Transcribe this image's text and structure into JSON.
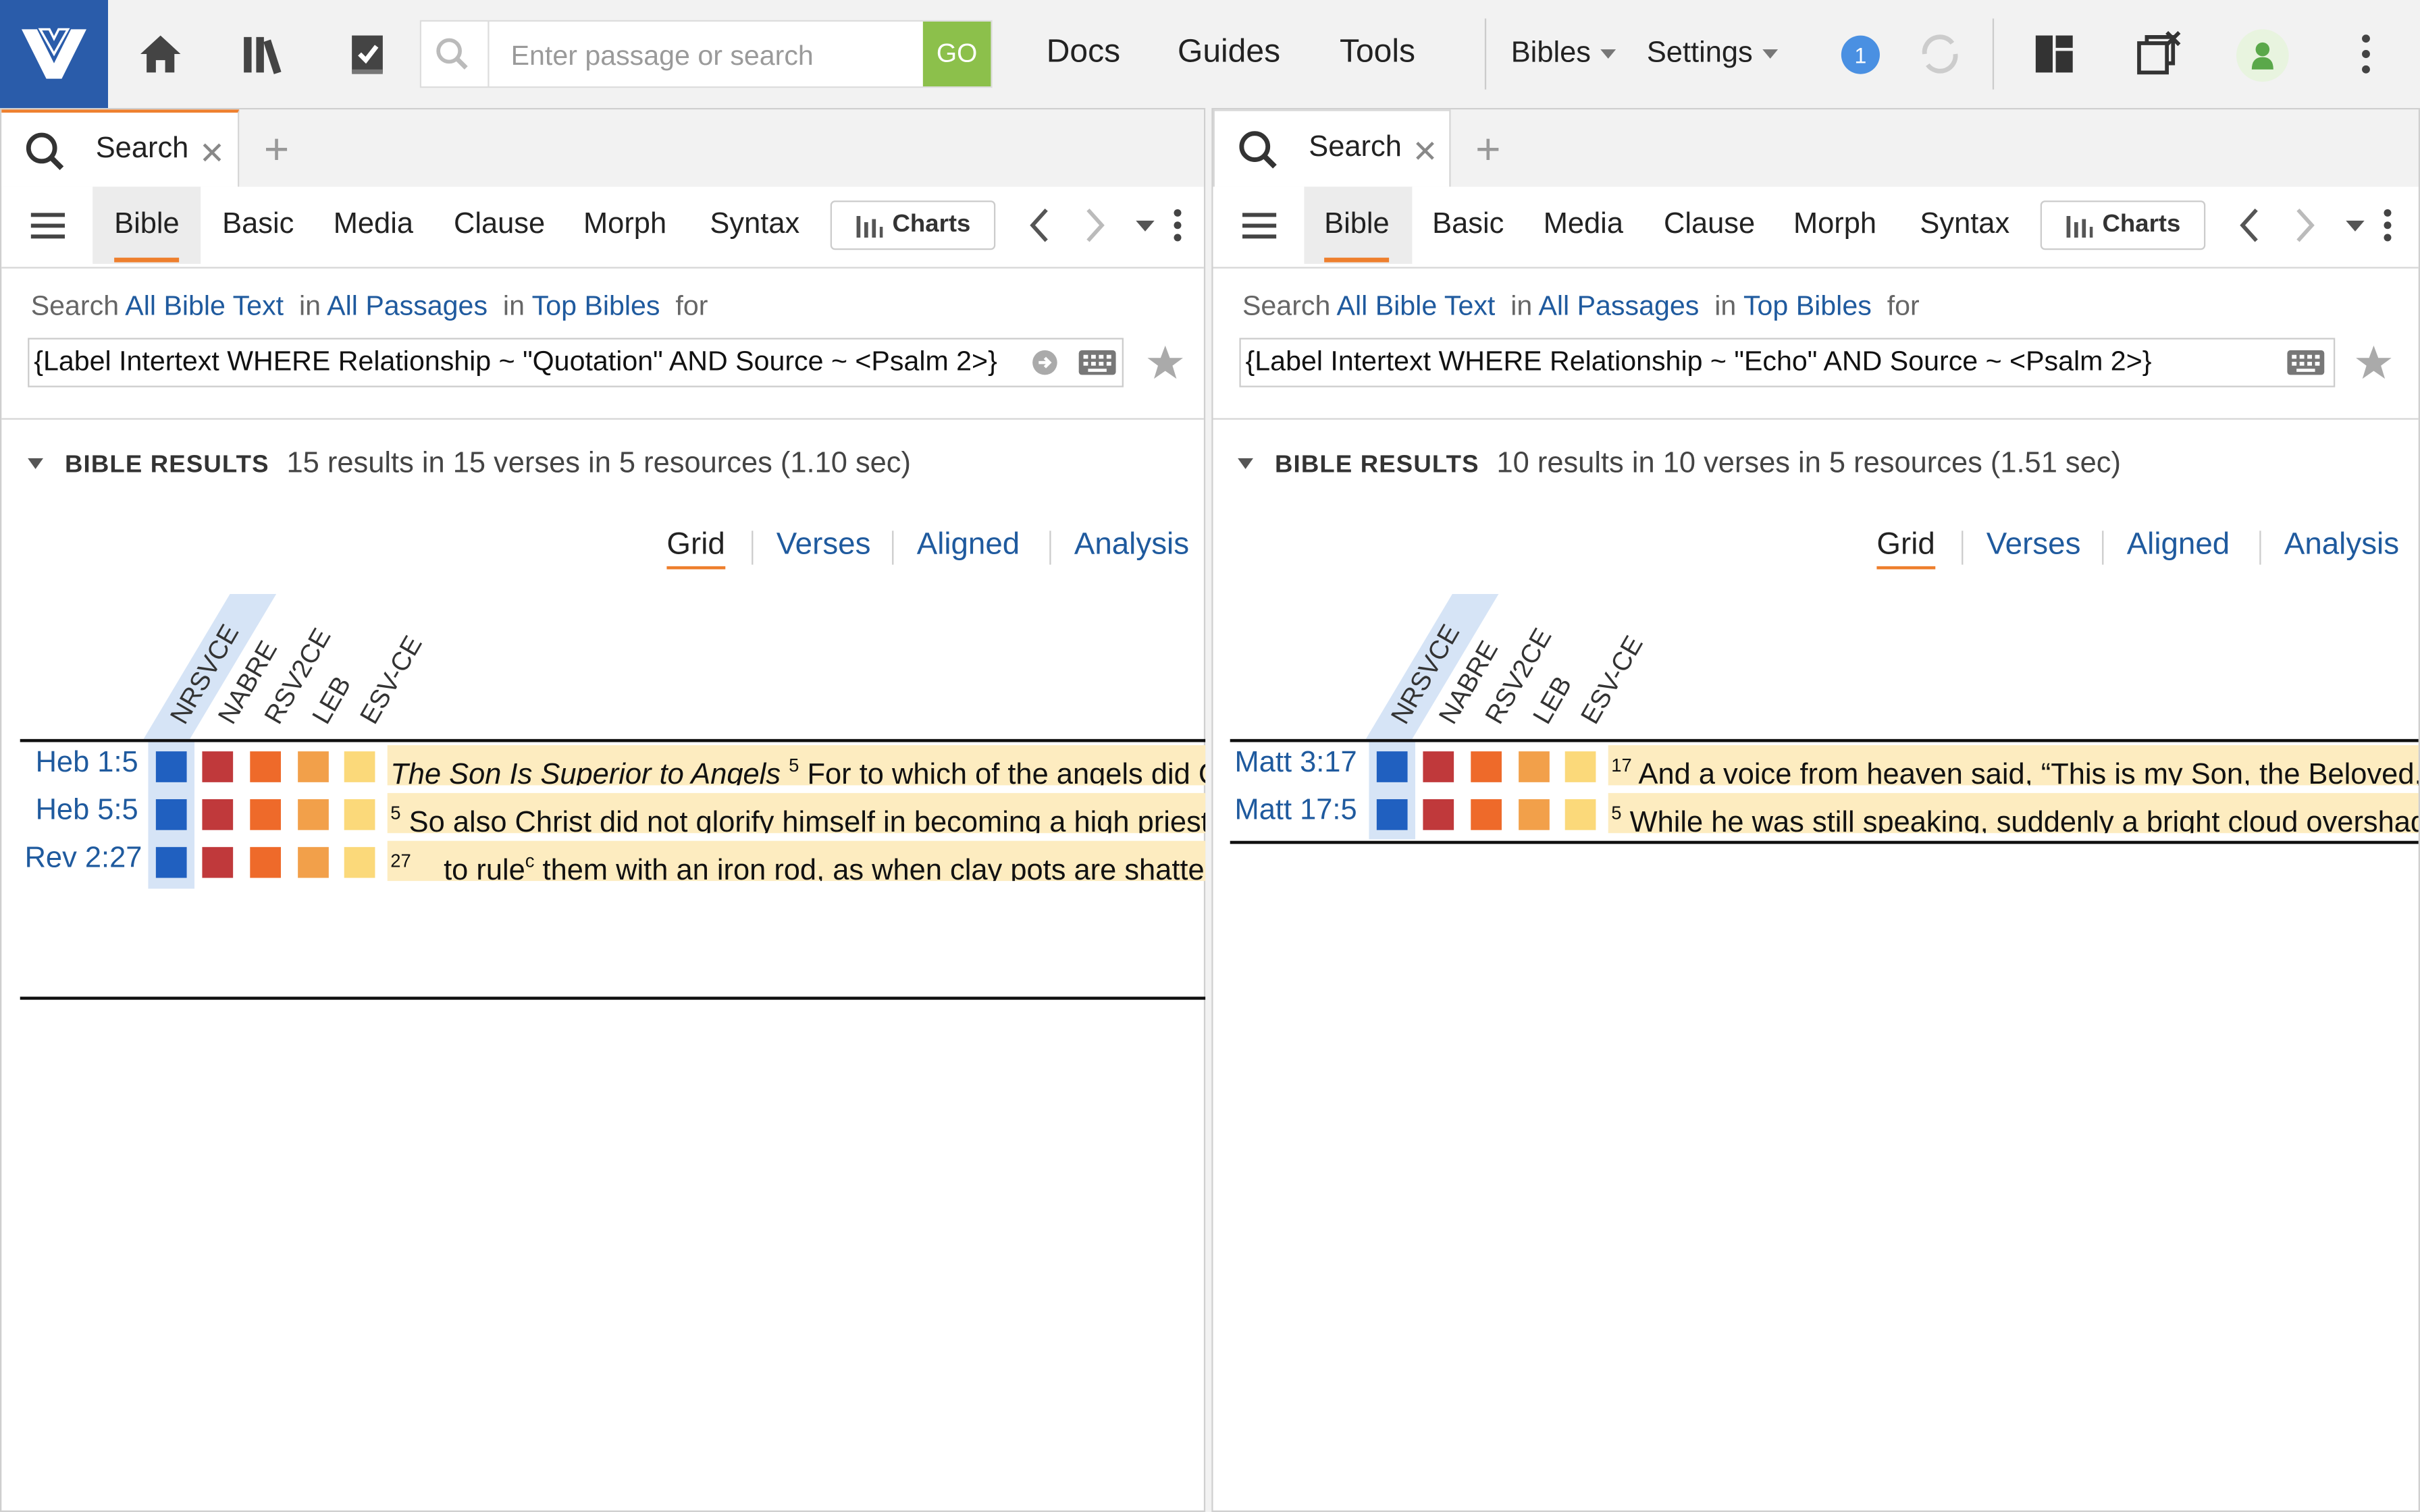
{
  "toolbar": {
    "search_placeholder": "Enter passage or search",
    "go_label": "GO",
    "menu": [
      "Docs",
      "Guides",
      "Tools"
    ],
    "bibles_label": "Bibles",
    "settings_label": "Settings",
    "badge_count": "1"
  },
  "colors": {
    "brand": "#2a5caa",
    "go": "#8cc04b",
    "accent": "#ee7f2d",
    "link": "#1f5a9e",
    "highlight": "#fdecc0",
    "resource_squares": [
      "#2060c0",
      "#c0393b",
      "#ee6a2a",
      "#f2a04a",
      "#fbd97a"
    ]
  },
  "panels": [
    {
      "tab_label": "Search",
      "subnav": [
        "Bible",
        "Basic",
        "Media",
        "Clause",
        "Morph",
        "Syntax"
      ],
      "charts_label": "Charts",
      "search_prefix": "Search",
      "scope": "All Bible Text",
      "in1": "in",
      "passages": "All Passages",
      "in2": "in",
      "bibles": "Top Bibles",
      "for": "for",
      "query": "{Label Intertext WHERE Relationship ~ \"Quotation\" AND Source ~ <Psalm 2>}",
      "results_label": "BIBLE RESULTS",
      "results_summary": "15 results in 15 verses in 5 resources (1.10 sec)",
      "views": [
        "Grid",
        "Verses",
        "Aligned",
        "Analysis"
      ],
      "columns": [
        "NRSVCE",
        "NABRE",
        "RSV2CE",
        "LEB",
        "ESV-CE"
      ],
      "rows": [
        {
          "ref": "Heb 1:5",
          "heading": "The Son Is Superior to Angels",
          "num": "5",
          "text": " For to which of the angels did God ever say, “You are my Son; today I have begotten you”?"
        },
        {
          "ref": "Heb 5:5",
          "heading": "",
          "num": "5",
          "text": " So also Christ did not glorify himself in becoming a high priest, but was appointed by the one who said to him,"
        },
        {
          "ref": "Rev 2:27",
          "heading": "",
          "num": "27",
          "text": "    to rule",
          "note": "c",
          "text2": " them with an iron rod, as when clay pots are shattered"
        }
      ]
    },
    {
      "tab_label": "Search",
      "subnav": [
        "Bible",
        "Basic",
        "Media",
        "Clause",
        "Morph",
        "Syntax"
      ],
      "charts_label": "Charts",
      "search_prefix": "Search",
      "scope": "All Bible Text",
      "in1": "in",
      "passages": "All Passages",
      "in2": "in",
      "bibles": "Top Bibles",
      "for": "for",
      "query": "{Label Intertext WHERE Relationship ~ \"Echo\" AND Source ~ <Psalm 2>}",
      "results_label": "BIBLE RESULTS",
      "results_summary": "10 results in 10 verses in 5 resources (1.51 sec)",
      "views": [
        "Grid",
        "Verses",
        "Aligned",
        "Analysis"
      ],
      "columns": [
        "NRSVCE",
        "NABRE",
        "RSV2CE",
        "LEB",
        "ESV-CE"
      ],
      "rows": [
        {
          "ref": "Matt 3:17",
          "heading": "",
          "num": "17",
          "text": " And a voice from heaven said, “This is my Son, the Beloved, with whom I am well pleased.”"
        },
        {
          "ref": "Matt 17:5",
          "heading": "",
          "num": "5",
          "text": " While he was still speaking, suddenly a bright cloud overshadowed them"
        }
      ]
    }
  ]
}
